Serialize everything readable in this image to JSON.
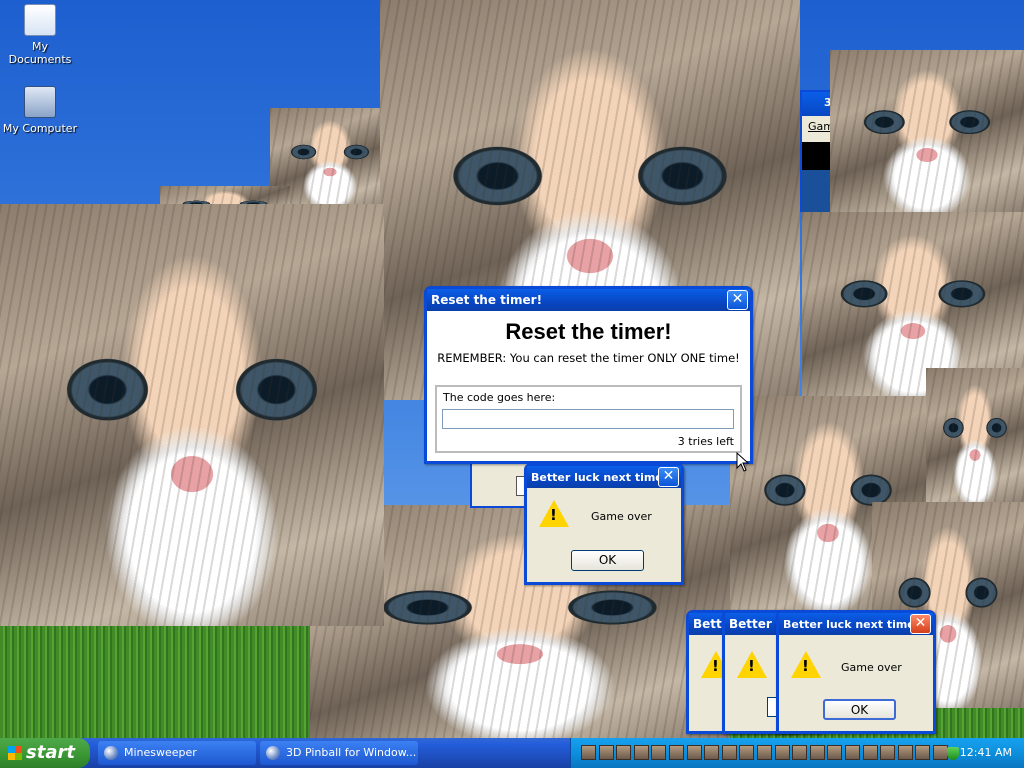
{
  "desktop": {
    "icons": [
      {
        "label": "My Documents",
        "icon": "folder-documents-icon"
      },
      {
        "label": "My Computer",
        "icon": "computer-icon"
      }
    ]
  },
  "reset_dialog": {
    "title": "Reset the timer!",
    "heading": "Reset the timer!",
    "remember": "REMEMBER: You can reset the timer ONLY ONE time!",
    "code_label": "The code goes here:",
    "code_value": "",
    "tries_count": "3",
    "tries_suffix": "tries left",
    "close": "✕"
  },
  "game_over_main": {
    "title": "Better luck next time!",
    "message": "Game over",
    "ok": "OK",
    "close": "✕"
  },
  "stacked_titles": {
    "a": "Bette",
    "b": "Better lu"
  },
  "game_over_front": {
    "title": "Better luck next time!",
    "message": "Game over",
    "ok": "OK",
    "close": "✕"
  },
  "bg_window": {
    "title_fragment": "3",
    "menu_fragment": "Gam"
  },
  "taskbar": {
    "start": "start",
    "tasks": [
      {
        "label": "Minesweeper",
        "icon": "minesweeper-icon"
      },
      {
        "label": "3D Pinball for Window...",
        "icon": "pinball-icon"
      }
    ],
    "clock": "12:41 AM"
  },
  "colors": {
    "accent": "#0a4ad6",
    "close_red": "#d43e1b",
    "warning": "#ffd400"
  }
}
